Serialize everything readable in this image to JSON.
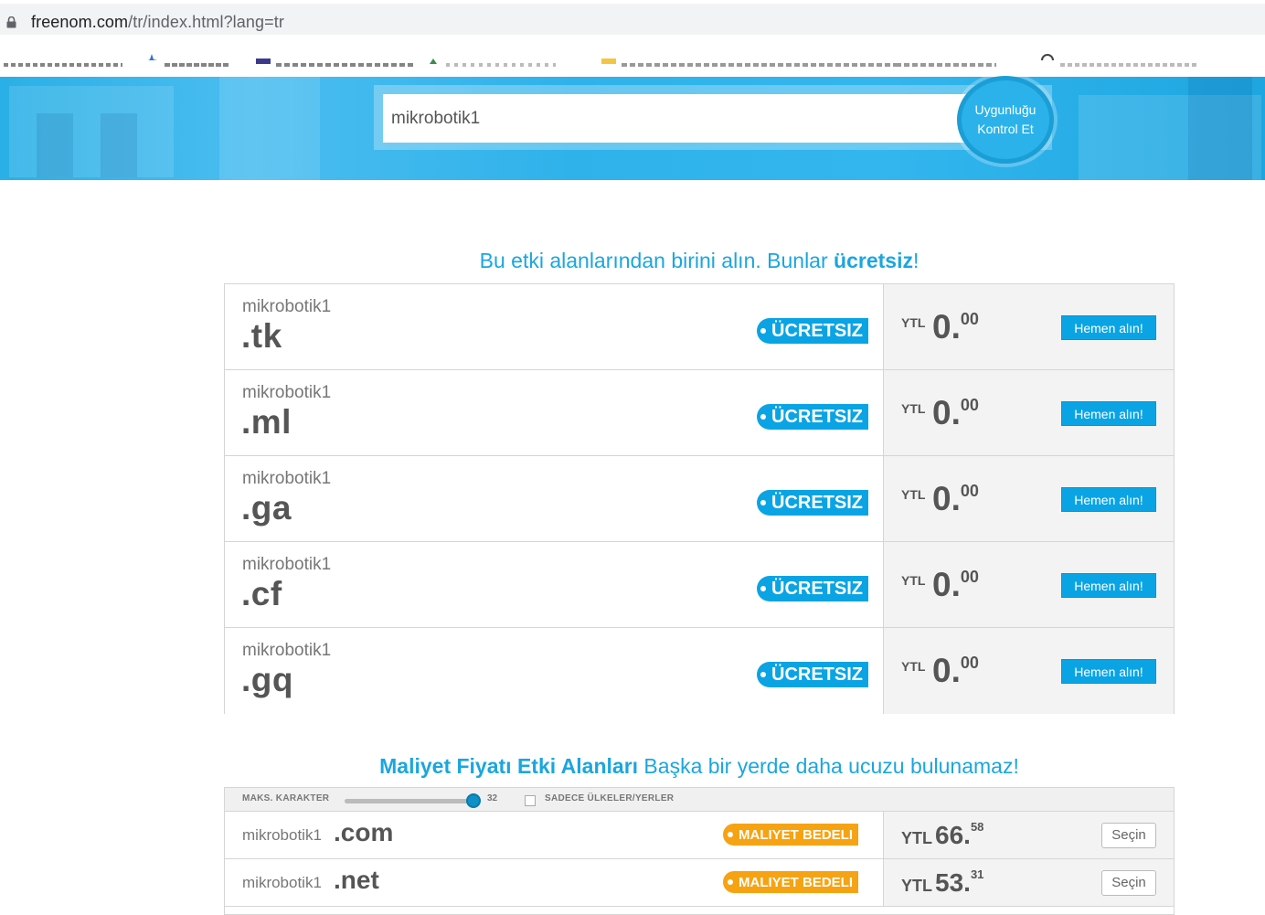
{
  "browser": {
    "url_host": "freenom.com",
    "url_path": "/tr/index.html?lang=tr"
  },
  "search": {
    "value": "mikrobotik1",
    "button_line1": "Uygunluğu",
    "button_line2": "Kontrol Et"
  },
  "free_section": {
    "heading_prefix": "Bu etki alanlarından birini alın. Bunlar ",
    "heading_bold": "ücretsiz",
    "heading_suffix": "!",
    "items": [
      {
        "name": "mikrobotik1",
        "tld": ".tk",
        "badge": "ÜCRETSIZ",
        "currency": "YTL",
        "price_int": "0",
        "price_dec": "00",
        "button": "Hemen alın!"
      },
      {
        "name": "mikrobotik1",
        "tld": ".ml",
        "badge": "ÜCRETSIZ",
        "currency": "YTL",
        "price_int": "0",
        "price_dec": "00",
        "button": "Hemen alın!"
      },
      {
        "name": "mikrobotik1",
        "tld": ".ga",
        "badge": "ÜCRETSIZ",
        "currency": "YTL",
        "price_int": "0",
        "price_dec": "00",
        "button": "Hemen alın!"
      },
      {
        "name": "mikrobotik1",
        "tld": ".cf",
        "badge": "ÜCRETSIZ",
        "currency": "YTL",
        "price_int": "0",
        "price_dec": "00",
        "button": "Hemen alın!"
      },
      {
        "name": "mikrobotik1",
        "tld": ".gq",
        "badge": "ÜCRETSIZ",
        "currency": "YTL",
        "price_int": "0",
        "price_dec": "00",
        "button": "Hemen alın!"
      }
    ]
  },
  "cost_section": {
    "heading_bold": "Maliyet Fiyatı Etki Alanları",
    "heading_rest": " Başka bir yerde daha ucuzu bulunamaz!",
    "filter": {
      "max_chars_label": "MAKS. KARAKTER",
      "max_chars_value": "32",
      "countries_label": "SADECE ÜLKELER/YERLER"
    },
    "items": [
      {
        "name": "mikrobotik1",
        "tld": ".com",
        "badge": "MALIYET BEDELI",
        "currency": "YTL",
        "price_int": "66",
        "price_dec": "58",
        "button": "Seçin"
      },
      {
        "name": "mikrobotik1",
        "tld": ".net",
        "badge": "MALIYET BEDELI",
        "currency": "YTL",
        "price_int": "53",
        "price_dec": "31",
        "button": "Seçin"
      }
    ]
  },
  "colors": {
    "accent": "#1ba6df",
    "free_badge": "#0aa4e4",
    "cost_badge": "#f6a313"
  }
}
